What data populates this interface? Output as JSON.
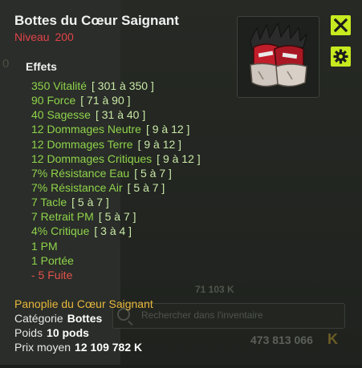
{
  "background": {
    "item_count": "71 103 K",
    "search_placeholder": "Rechercher dans l'inventaire",
    "kamas_total": "473 813 066"
  },
  "tooltip": {
    "title": "Bottes du Cœur Saignant",
    "level_label": "Niveau",
    "level_value": "200",
    "effects_label": "Effets",
    "effects": [
      {
        "text": "350 Vitalité",
        "range": "[ 301 à 350 ]"
      },
      {
        "text": "90 Force",
        "range": "[ 71 à 90 ]"
      },
      {
        "text": "40 Sagesse",
        "range": "[ 31 à 40 ]"
      },
      {
        "text": "12 Dommages Neutre",
        "range": "[ 9 à 12 ]"
      },
      {
        "text": "12 Dommages Terre",
        "range": "[ 9 à 12 ]"
      },
      {
        "text": "12 Dommages Critiques",
        "range": "[ 9 à 12 ]"
      },
      {
        "text": "7% Résistance Eau",
        "range": "[ 5 à 7 ]"
      },
      {
        "text": "7% Résistance Air",
        "range": "[ 5 à 7 ]"
      },
      {
        "text": "7 Tacle",
        "range": "[ 5 à 7 ]"
      },
      {
        "text": "7 Retrait PM",
        "range": "[ 5 à 7 ]"
      },
      {
        "text": "4% Critique",
        "range": "[ 3 à 4 ]"
      },
      {
        "text": "1 PM",
        "range": ""
      },
      {
        "text": "1 Portée",
        "range": ""
      },
      {
        "text": "- 5 Fuite",
        "range": "",
        "negative": true
      }
    ],
    "set_name": "Panoplie du Cœur Saignant",
    "category_label": "Catégorie",
    "category_value": "Bottes",
    "weight_label": "Poids",
    "weight_value": "10 pods",
    "price_label": "Prix moyen",
    "price_value": "12 109 782 K"
  },
  "icons": {
    "close": "close-icon",
    "settings": "gear-icon",
    "item": "boots-item-icon",
    "search": "search-icon",
    "kamas": "kamas-icon"
  },
  "colors": {
    "accent_button": "#c6ea1f",
    "effect_positive": "#8fd34b",
    "effect_negative": "#e4514d",
    "level": "#e4424a",
    "set_name": "#e8b73c"
  }
}
